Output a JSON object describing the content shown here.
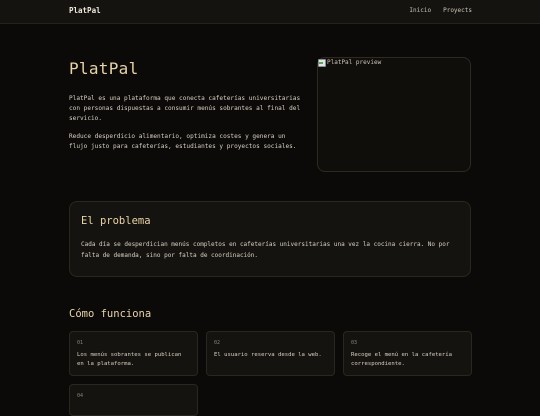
{
  "header": {
    "brand": "PlatPal",
    "nav": [
      {
        "label": "Inicio"
      },
      {
        "label": "Proyects"
      }
    ]
  },
  "hero": {
    "title": "PlatPal",
    "paragraph1": "PlatPal es una plataforma que conecta cafeterías universitarias con personas dispuestas a consumir menús sobrantes al final del servicio.",
    "paragraph2": "Reduce desperdicio alimentario, optimiza costes y genera un flujo justo para cafeterías, estudiantes y proyectos sociales.",
    "image_alt": "PlatPal preview",
    "image_icon": "broken-image-icon"
  },
  "problem": {
    "title": "El problema",
    "text": "Cada día se desperdician menús completos en cafeterías universitarias una vez la cocina cierra. No por falta de demanda, sino por falta de coordinación."
  },
  "how": {
    "title": "Cómo funciona",
    "steps": [
      {
        "num": "01",
        "text": "Los menús sobrantes se publican en la plataforma."
      },
      {
        "num": "02",
        "text": "El usuario reserva desde la web."
      },
      {
        "num": "03",
        "text": "Recoge el menú en la cafetería correspondiente."
      },
      {
        "num": "04",
        "text": ""
      }
    ]
  }
}
